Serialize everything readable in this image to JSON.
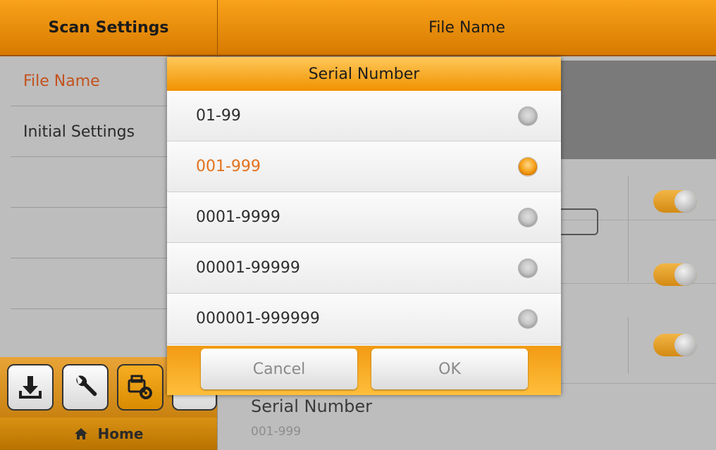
{
  "header": {
    "left_title": "Scan Settings",
    "right_title": "File Name"
  },
  "sidebar": {
    "items": [
      {
        "label": "File Name"
      },
      {
        "label": "Initial Settings"
      },
      {
        "label": ""
      },
      {
        "label": ""
      },
      {
        "label": ""
      }
    ]
  },
  "toolbar": {
    "buttons": [
      {
        "icon": "download-icon"
      },
      {
        "icon": "wrench-icon"
      },
      {
        "icon": "scanner-settings-icon"
      },
      {
        "icon": "gear-icon"
      }
    ],
    "home_label": "Home"
  },
  "main": {
    "serial_title": "Serial Number",
    "serial_value": "001-999"
  },
  "dialog": {
    "title": "Serial Number",
    "options": [
      {
        "label": "01-99"
      },
      {
        "label": "001-999"
      },
      {
        "label": "0001-9999"
      },
      {
        "label": "00001-99999"
      },
      {
        "label": "000001-999999"
      }
    ],
    "selected_index": 1,
    "cancel_label": "Cancel",
    "ok_label": "OK"
  },
  "colors": {
    "accent": "#f39a12",
    "selected_text": "#e2711d"
  }
}
